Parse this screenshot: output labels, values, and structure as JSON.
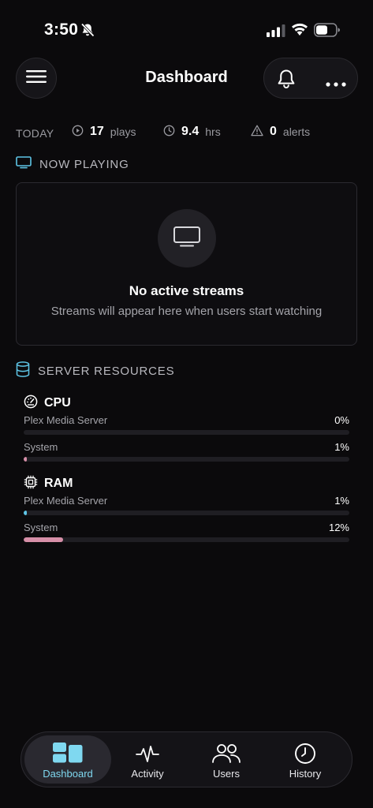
{
  "status_bar": {
    "time": "3:50"
  },
  "header": {
    "title": "Dashboard"
  },
  "today": {
    "label": "TODAY",
    "plays": {
      "value": "17",
      "unit": "plays"
    },
    "hours": {
      "value": "9.4",
      "unit": "hrs"
    },
    "alerts": {
      "value": "0",
      "unit": "alerts"
    }
  },
  "now_playing": {
    "heading": "NOW PLAYING",
    "empty_title": "No active streams",
    "empty_subtitle": "Streams will appear here when users start watching"
  },
  "server_resources": {
    "heading": "SERVER RESOURCES",
    "cpu": {
      "title": "CPU",
      "rows": [
        {
          "label": "Plex Media Server",
          "percent_text": "0%",
          "fraction": 0.0,
          "color": "#d68fa8"
        },
        {
          "label": "System",
          "percent_text": "1%",
          "fraction": 0.01,
          "color": "#d68fa8"
        }
      ]
    },
    "ram": {
      "title": "RAM",
      "rows": [
        {
          "label": "Plex Media Server",
          "percent_text": "1%",
          "fraction": 0.01,
          "color": "#5ec5e6"
        },
        {
          "label": "System",
          "percent_text": "12%",
          "fraction": 0.12,
          "color": "#d68fa8"
        }
      ]
    }
  },
  "tabs": [
    {
      "label": "Dashboard",
      "icon": "dashboard-icon",
      "active": true
    },
    {
      "label": "Activity",
      "icon": "activity-icon",
      "active": false
    },
    {
      "label": "Users",
      "icon": "users-icon",
      "active": false
    },
    {
      "label": "History",
      "icon": "history-icon",
      "active": false
    }
  ],
  "colors": {
    "accent": "#7fd8f0",
    "background": "#0b0a0c"
  }
}
